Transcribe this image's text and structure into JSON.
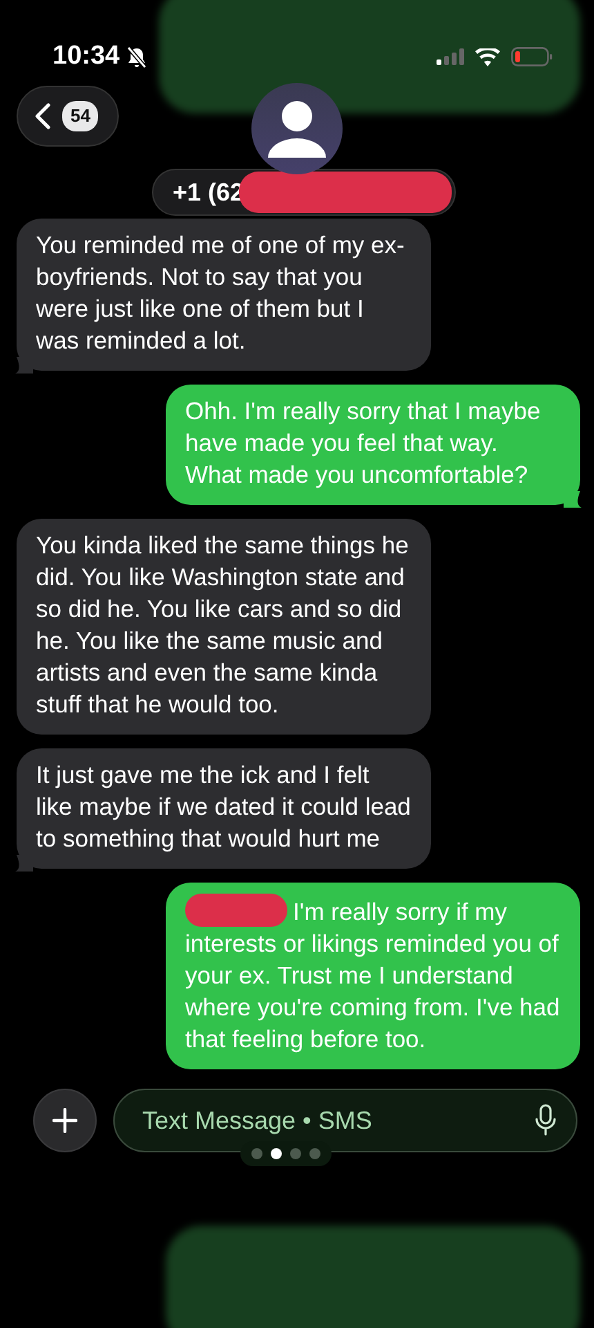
{
  "status_bar": {
    "time": "10:34"
  },
  "header": {
    "back_count": "54",
    "contact": "+1 (62"
  },
  "messages": [
    {
      "kind": "incoming",
      "tail": true,
      "redacted": false,
      "text": "You reminded me of one of my ex-boyfriends. Not to say that you were just like one of them but I was reminded a lot."
    },
    {
      "kind": "outgoing",
      "tail": true,
      "redacted": false,
      "text": "Ohh. I'm really sorry that I maybe have made you feel that way. What made you uncomfortable?"
    },
    {
      "kind": "incoming",
      "tail": false,
      "redacted": false,
      "text": "You kinda liked the same things he did. You like Washington state and so did he. You like cars and so did he. You like the same music and artists and even the same kinda stuff that he would too."
    },
    {
      "kind": "incoming",
      "tail": true,
      "redacted": false,
      "text": "It just gave me the ick and I felt like maybe if we dated it could lead to something that would hurt me"
    },
    {
      "kind": "outgoing",
      "tail": false,
      "redacted": true,
      "text": "I'm really sorry if my interests or likings reminded you of your ex. Trust me I understand where you're coming from. I've had that feeling before too."
    }
  ],
  "composer": {
    "placeholder": "Text Message • SMS"
  },
  "page_dots": [
    {
      "selected": false
    },
    {
      "selected": true
    },
    {
      "selected": false
    },
    {
      "selected": false
    }
  ]
}
